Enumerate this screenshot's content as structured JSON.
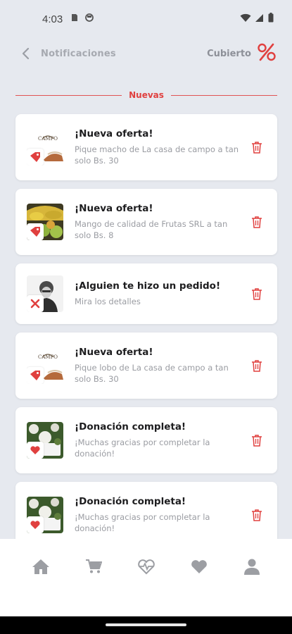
{
  "status_bar": {
    "time": "4:03"
  },
  "header": {
    "title": "Notificaciones",
    "brand": "Cubierto"
  },
  "section": {
    "label": "Nuevas"
  },
  "notifications": [
    {
      "title": "¡Nueva oferta!",
      "body": "Pique macho de La casa de campo a tan solo Bs. 30",
      "badge": "tag-icon"
    },
    {
      "title": "¡Nueva oferta!",
      "body": "Mango de calidad de Frutas SRL a tan solo Bs. 8",
      "badge": "tag-icon"
    },
    {
      "title": "¡Alguien te hizo un pedido!",
      "body": "Mira los detalles",
      "badge": "cross-icon"
    },
    {
      "title": "¡Nueva oferta!",
      "body": "Pique lobo de La casa de campo a tan solo Bs. 30",
      "badge": "tag-icon"
    },
    {
      "title": "¡Donación completa!",
      "body": "¡Muchas gracias por completar la donación!",
      "badge": "heart-icon"
    },
    {
      "title": "¡Donación completa!",
      "body": "¡Muchas gracias por completar la donación!",
      "badge": "heart-icon"
    }
  ],
  "bottom_nav": [
    "home-icon",
    "cart-icon",
    "health-icon",
    "heart-icon",
    "user-icon"
  ],
  "colors": {
    "accent": "#e0403f",
    "background": "#e6e9ef",
    "card": "#ffffff"
  }
}
